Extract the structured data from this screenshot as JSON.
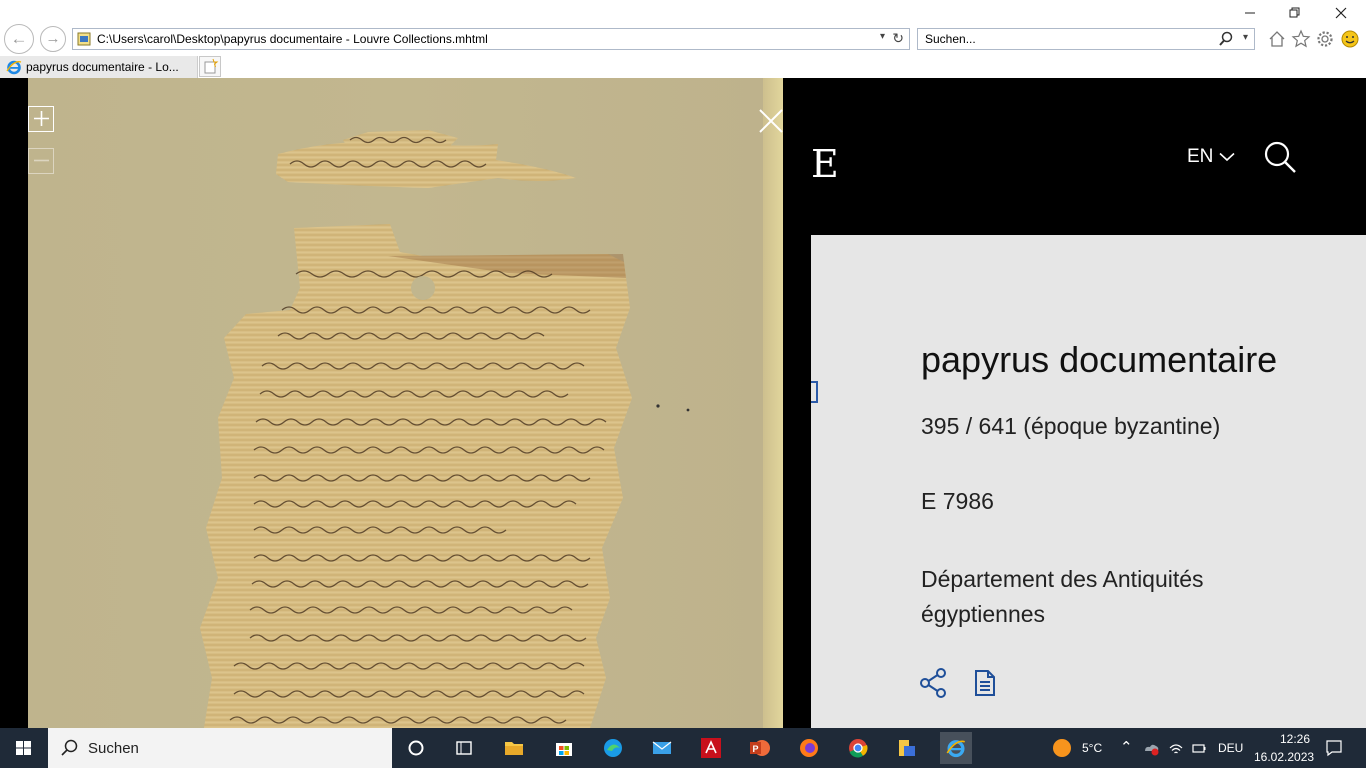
{
  "browser": {
    "url": "C:\\Users\\carol\\Desktop\\papyrus documentaire - Louvre Collections.mhtml",
    "search_placeholder": "Suchen...",
    "tab_title": "papyrus documentaire - Lo...",
    "icons": [
      "back-icon",
      "forward-icon",
      "page-icon",
      "dropdown-icon",
      "refresh-icon",
      "search-icon",
      "home-icon",
      "favorites-star-icon",
      "settings-gear-icon",
      "smiley-feedback-icon",
      "minimize-icon",
      "restore-icon",
      "close-icon",
      "ie-icon",
      "new-tab-icon"
    ]
  },
  "viewer": {
    "zoom_in_icon": "plus-icon",
    "zoom_out_icon": "minus-icon",
    "close_icon": "close-x-icon"
  },
  "site": {
    "logo": "E",
    "lang": "EN",
    "search_icon": "search-icon"
  },
  "artwork": {
    "title": "papyrus documentaire",
    "date": "395 / 641 (époque byzantine)",
    "inventory": "E 7986",
    "department": "Département des Antiquités égyptiennes",
    "icons": [
      "share-icon",
      "document-icon"
    ]
  },
  "taskbar": {
    "search_label": "Suchen",
    "temperature": "5°C",
    "language": "DEU",
    "time": "12:26",
    "date": "16.02.2023",
    "apps": [
      "task-view",
      "widgets",
      "file-explorer",
      "microsoft-store",
      "edge",
      "mail",
      "acrobat",
      "powerpoint",
      "firefox",
      "chrome",
      "explorer-folder",
      "internet-explorer"
    ]
  },
  "colors": {
    "viewport_bg": "#000000",
    "info_bg": "#e6e6e6",
    "papyrus": "#d8bf84",
    "taskbar_bg": "#1f2a38"
  }
}
